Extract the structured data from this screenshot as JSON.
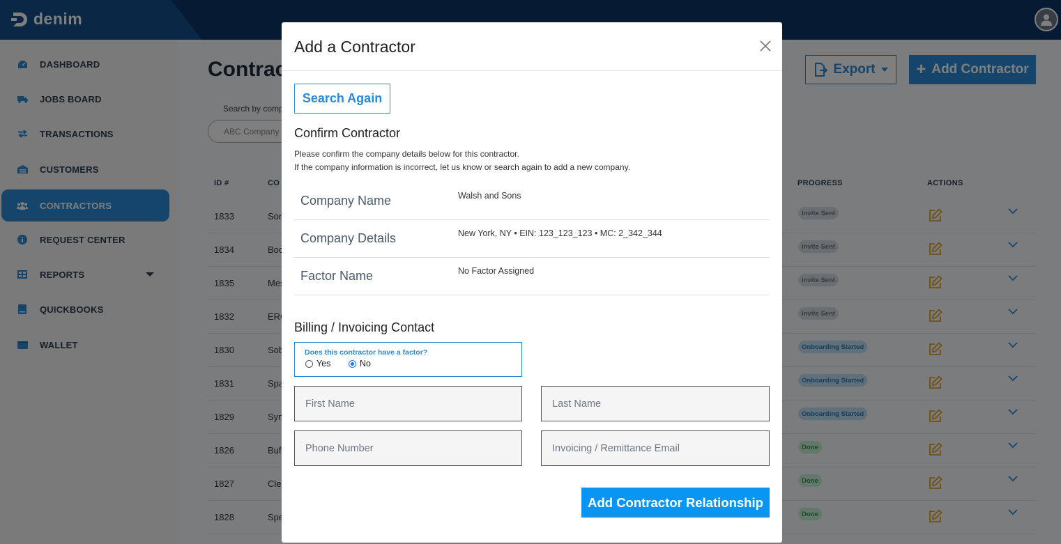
{
  "app": {
    "logo_text": "denim"
  },
  "sidebar": {
    "items": [
      {
        "label": "DASHBOARD",
        "icon": "gauge-icon"
      },
      {
        "label": "JOBS BOARD",
        "icon": "truck-icon"
      },
      {
        "label": "TRANSACTIONS",
        "icon": "exchange-icon"
      },
      {
        "label": "CUSTOMERS",
        "icon": "warehouse-icon"
      },
      {
        "label": "CONTRACTORS",
        "icon": "users-icon",
        "active": true
      },
      {
        "label": "REQUEST CENTER",
        "icon": "info-icon"
      },
      {
        "label": "REPORTS",
        "icon": "table-icon"
      },
      {
        "label": "QUICKBOOKS",
        "icon": "book-icon"
      },
      {
        "label": "WALLET",
        "icon": "wallet-icon"
      }
    ]
  },
  "page": {
    "title": "Contract",
    "export_label": "Export",
    "add_label": "Add Contractor",
    "search_label": "Search by comp",
    "search_placeholder": "ABC Company",
    "columns": {
      "id": "ID #",
      "company": "CO",
      "progress": "PROGRESS",
      "actions": "ACTIONS"
    },
    "rows": [
      {
        "id": "1833",
        "company": "Son",
        "status": "Invite Sent",
        "kind": "sent"
      },
      {
        "id": "1834",
        "company": "Boo",
        "status": "Invite Sent",
        "kind": "sent"
      },
      {
        "id": "1835",
        "company": "Mes",
        "status": "Invite Sent",
        "kind": "sent"
      },
      {
        "id": "1832",
        "company": "ERC",
        "status": "Invite Sent",
        "kind": "sent"
      },
      {
        "id": "1830",
        "company": "Sob",
        "status": "Onboarding Started",
        "kind": "onb"
      },
      {
        "id": "1831",
        "company": "Spa",
        "status": "Onboarding Started",
        "kind": "onb"
      },
      {
        "id": "1829",
        "company": "Syn",
        "status": "Onboarding Started",
        "kind": "onb"
      },
      {
        "id": "1826",
        "company": "Buf",
        "status": "Done",
        "kind": "done"
      },
      {
        "id": "1827",
        "company": "Cle",
        "status": "Done",
        "kind": "done"
      },
      {
        "id": "1828",
        "company": "Spe",
        "status": "Done",
        "kind": "done"
      }
    ]
  },
  "modal": {
    "title": "Add a Contractor",
    "search_again": "Search Again",
    "confirm_title": "Confirm Contractor",
    "confirm_line1": "Please confirm the company details below for this contractor.",
    "confirm_line2": "If the company information is incorrect, let us know or search again to add a new company.",
    "info": {
      "company_name_label": "Company Name",
      "company_name_value": "Walsh and Sons",
      "company_details_label": "Company Details",
      "company_details_value": "New York, NY • EIN: 123_123_123 • MC: 2_342_344",
      "factor_name_label": "Factor Name",
      "factor_name_value": "No Factor Assigned"
    },
    "billing_title": "Billing / Invoicing Contact",
    "factor_question": "Does this contractor have a factor?",
    "radio_yes": "Yes",
    "radio_no": "No",
    "radio_selected": "No",
    "fields": {
      "first_name": "First Name",
      "last_name": "Last Name",
      "phone": "Phone Number",
      "email": "Invoicing / Remittance Email"
    },
    "submit": "Add Contractor Relationship"
  },
  "colors": {
    "topbar": "#0c3766",
    "accent": "#2a8ad6",
    "submit": "#0b95f2",
    "edit_icon": "#e0a021"
  }
}
